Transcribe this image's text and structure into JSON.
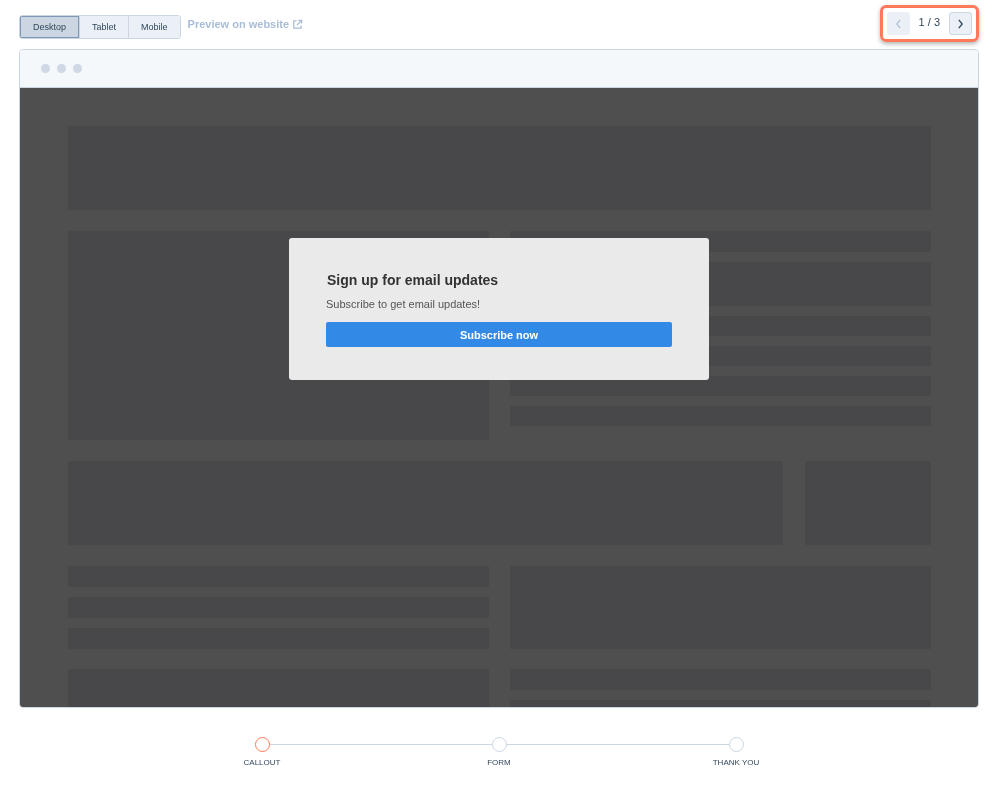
{
  "device_tabs": [
    {
      "label": "Desktop",
      "selected": true
    },
    {
      "label": "Tablet",
      "selected": false
    },
    {
      "label": "Mobile",
      "selected": false
    }
  ],
  "preview_link": "Preview on website",
  "pager": {
    "text": "1 / 3",
    "prev_disabled": true,
    "highlighted": true
  },
  "popup": {
    "title": "Sign up for email updates",
    "text": "Subscribe to get email updates!",
    "button": "Subscribe now"
  },
  "steps": [
    {
      "label": "CALLOUT",
      "selected": true
    },
    {
      "label": "FORM",
      "selected": false
    },
    {
      "label": "THANK YOU",
      "selected": false
    }
  ]
}
